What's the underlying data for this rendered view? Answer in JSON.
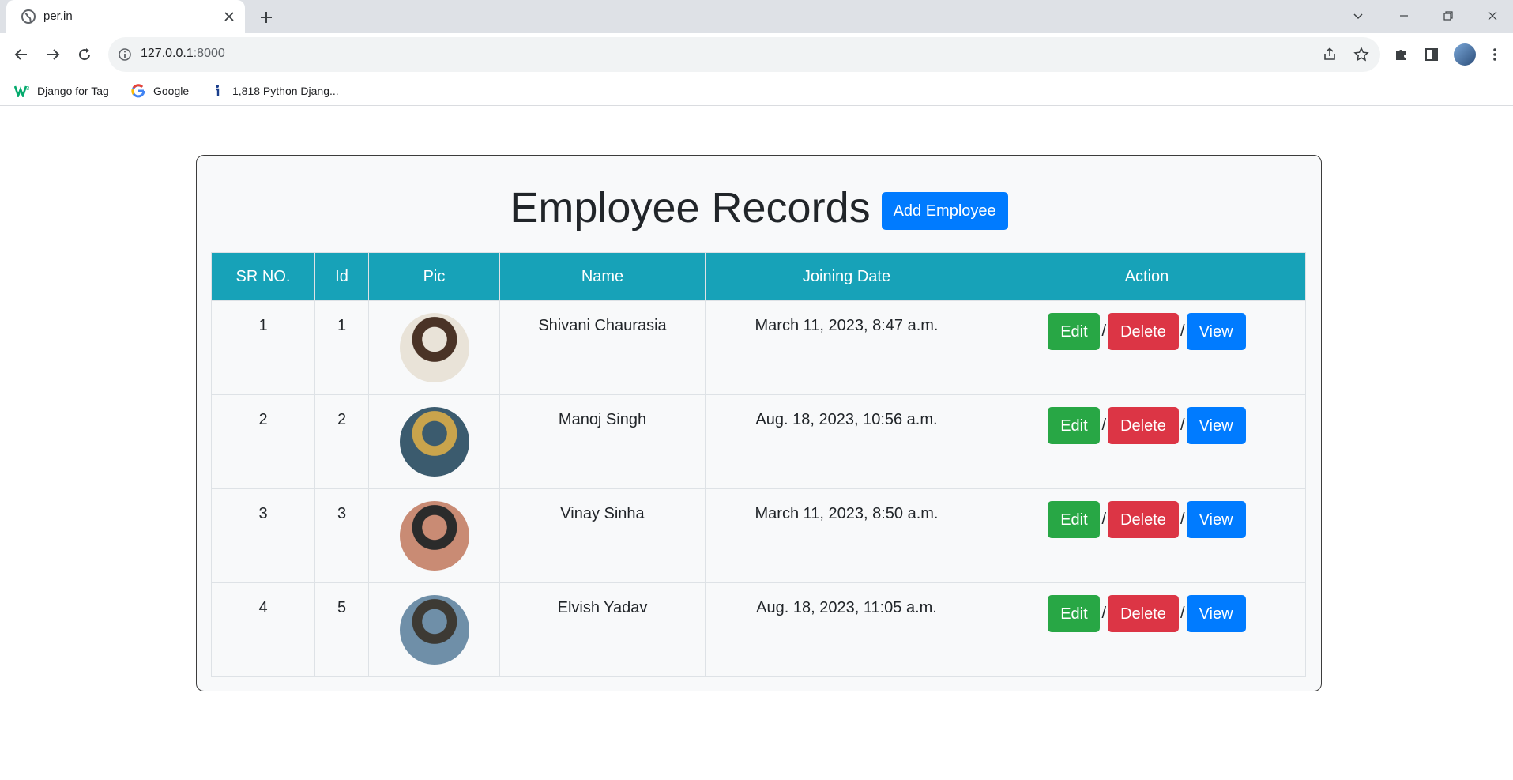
{
  "browser": {
    "tab_title": "per.in",
    "url_host": "127.0.0.1",
    "url_port": ":8000",
    "bookmarks": [
      {
        "label": "Django for Tag",
        "icon": "w3schools-icon"
      },
      {
        "label": "Google",
        "icon": "google-icon"
      },
      {
        "label": "1,818 Python Djang...",
        "icon": "info-icon"
      }
    ]
  },
  "page": {
    "title": "Employee Records",
    "add_button_label": "Add Employee"
  },
  "table": {
    "headers": [
      "SR NO.",
      "Id",
      "Pic",
      "Name",
      "Joining Date",
      "Action"
    ],
    "rows": [
      {
        "sr": "1",
        "id": "1",
        "name": "Shivani Chaurasia",
        "joining_date": "March 11, 2023, 8:47 a.m.",
        "pic_colors": [
          "#e9e3d8",
          "#4a3326"
        ]
      },
      {
        "sr": "2",
        "id": "2",
        "name": "Manoj Singh",
        "joining_date": "Aug. 18, 2023, 10:56 a.m.",
        "pic_colors": [
          "#3b5b6e",
          "#c9a44c"
        ]
      },
      {
        "sr": "3",
        "id": "3",
        "name": "Vinay Sinha",
        "joining_date": "March 11, 2023, 8:50 a.m.",
        "pic_colors": [
          "#c98b74",
          "#2b2b2b"
        ]
      },
      {
        "sr": "4",
        "id": "5",
        "name": "Elvish Yadav",
        "joining_date": "Aug. 18, 2023, 11:05 a.m.",
        "pic_colors": [
          "#6f8fa8",
          "#3d3a34"
        ]
      }
    ],
    "action_labels": {
      "edit": "Edit",
      "delete": "Delete",
      "view": "View",
      "separator": "/"
    }
  },
  "colors": {
    "header_bg": "#17a2b8",
    "edit": "#28a745",
    "delete": "#dc3545",
    "view": "#007bff"
  }
}
